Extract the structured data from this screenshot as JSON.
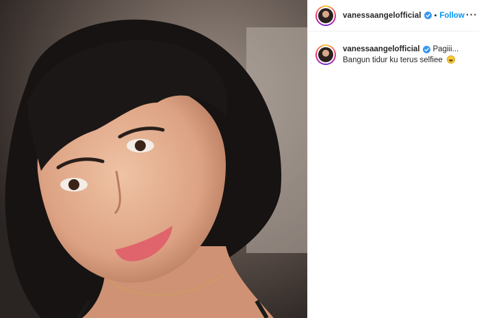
{
  "post": {
    "username": "vanessaangelofficial",
    "verified_icon": "verified-badge-icon",
    "separator": "•",
    "follow_label": "Follow",
    "more_label": "···",
    "caption_username": "vanessaangelofficial",
    "caption_line1": "Pagiii...",
    "caption_line2": "Bangun tidur ku terus selfiee",
    "caption_emoji": "laughing-emoji-icon"
  },
  "colors": {
    "link_blue": "#0095f6",
    "verified_blue": "#3897f0",
    "text": "#262626"
  }
}
